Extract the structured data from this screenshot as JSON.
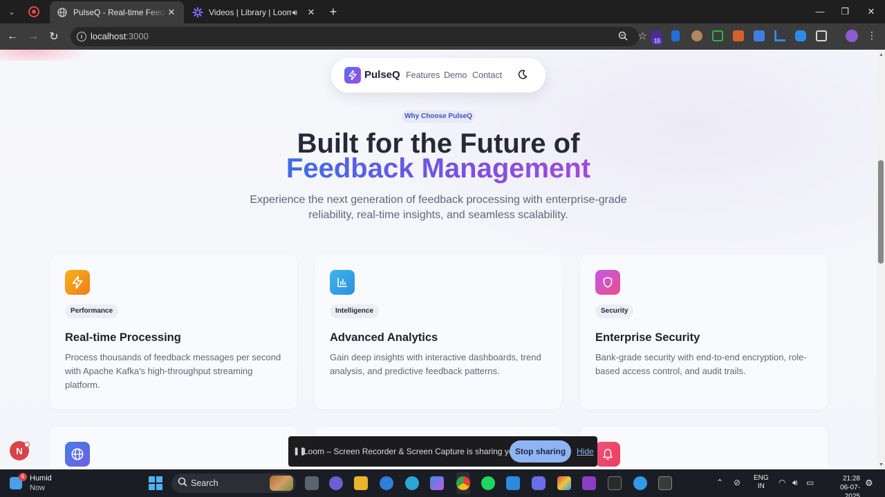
{
  "browser": {
    "tabs": [
      {
        "title": "PulseQ - Real-time Feedback Pl",
        "active": true
      },
      {
        "title": "Videos | Library | Loom",
        "active": false
      }
    ],
    "address": {
      "host": "localhost",
      "port": ":3000"
    },
    "extension_badge": "15"
  },
  "site": {
    "nav": {
      "brand": "PulseQ",
      "links": [
        "Features",
        "Demo",
        "Contact"
      ]
    },
    "hero": {
      "eyebrow": "Why Choose PulseQ",
      "title_line1": "Built for the Future of",
      "title_line2": "Feedback Management",
      "subtitle_line1": "Experience the next generation of feedback processing with enterprise-grade",
      "subtitle_line2": "reliability, real-time insights, and seamless scalability."
    },
    "features": [
      {
        "tag": "Performance",
        "title": "Real-time Processing",
        "desc": "Process thousands of feedback messages per second with Apache Kafka's high-throughput streaming platform.",
        "icon": "lightning-icon",
        "color_from": "#f6b320",
        "color_to": "#f07c14"
      },
      {
        "tag": "Intelligence",
        "title": "Advanced Analytics",
        "desc": "Gain deep insights with interactive dashboards, trend analysis, and predictive feedback patterns.",
        "icon": "bar-chart-icon",
        "color_from": "#3db6e8",
        "color_to": "#2f8ee0"
      },
      {
        "tag": "Security",
        "title": "Enterprise Security",
        "desc": "Bank-grade security with end-to-end encryption, role-based access control, and audit trails.",
        "icon": "shield-icon",
        "color_from": "#c457e8",
        "color_to": "#e8508a"
      }
    ],
    "next_row_icons": [
      "globe-icon",
      "bell-icon"
    ]
  },
  "loom": {
    "message": "Loom – Screen Recorder & Screen Capture is sharing your screen.",
    "stop_label": "Stop sharing",
    "hide_label": "Hide"
  },
  "n_badge": "N",
  "taskbar": {
    "weather_badge": "6",
    "weather_title": "Humid",
    "weather_sub": "Now",
    "search_label": "Search",
    "lang_line1": "ENG",
    "lang_line2": "IN",
    "time": "21:28",
    "date": "06-07-2025"
  }
}
